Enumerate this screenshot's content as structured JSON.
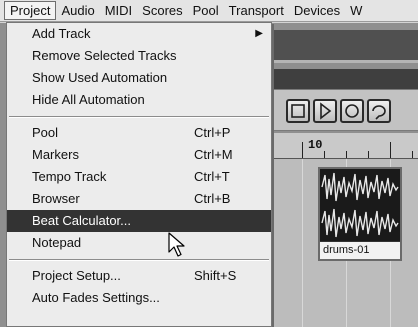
{
  "menubar": {
    "items": [
      "Project",
      "Audio",
      "MIDI",
      "Scores",
      "Pool",
      "Transport",
      "Devices",
      "W"
    ],
    "active_index": 0
  },
  "project_menu": {
    "groups": [
      [
        {
          "label": "Add Track",
          "submenu": true
        },
        {
          "label": "Remove Selected Tracks"
        },
        {
          "label": "Show Used Automation"
        },
        {
          "label": "Hide All Automation"
        }
      ],
      [
        {
          "label": "Pool",
          "shortcut": "Ctrl+P"
        },
        {
          "label": "Markers",
          "shortcut": "Ctrl+M"
        },
        {
          "label": "Tempo Track",
          "shortcut": "Ctrl+T"
        },
        {
          "label": "Browser",
          "shortcut": "Ctrl+B"
        },
        {
          "label": "Beat Calculator...",
          "highlighted": true
        },
        {
          "label": "Notepad"
        }
      ],
      [
        {
          "label": "Project Setup...",
          "shortcut": "Shift+S"
        },
        {
          "label": "Auto Fades Settings..."
        }
      ]
    ]
  },
  "ruler": {
    "label": "10"
  },
  "event": {
    "label": "drums-01"
  },
  "transport_buttons": [
    {
      "name": "cycle-button",
      "icon": "square-icon"
    },
    {
      "name": "play-button",
      "icon": "play-icon"
    },
    {
      "name": "record-button",
      "icon": "record-icon"
    },
    {
      "name": "loop-button",
      "icon": "loop-icon"
    }
  ],
  "colors": {
    "highlight": "#333333",
    "menu_bg": "#ececec",
    "menubar_bg": "#e4e4e4"
  }
}
